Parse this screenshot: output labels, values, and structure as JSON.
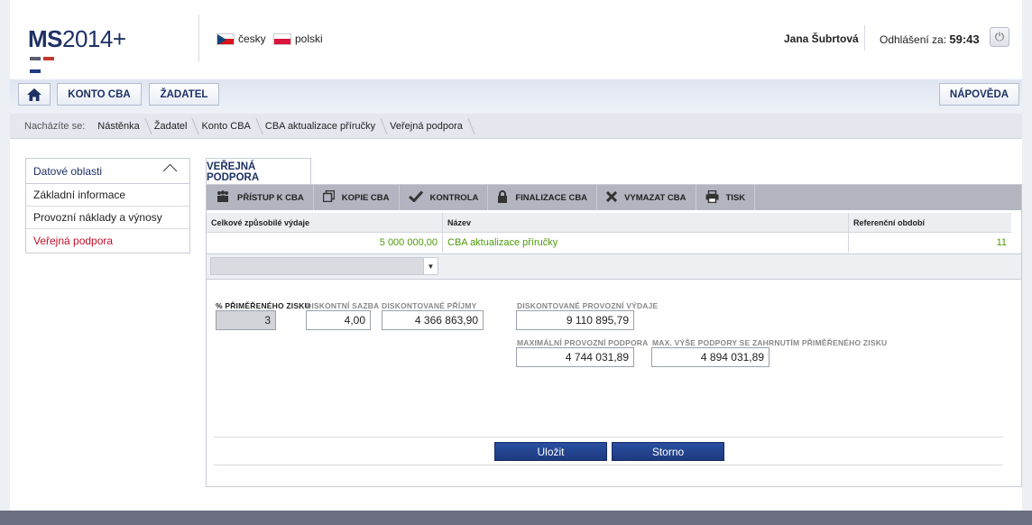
{
  "logo": {
    "bold": "MS",
    "rest": "2014+",
    "bar_colors": [
      "#5a6070",
      "#c0392b",
      "#1e3a80"
    ]
  },
  "languages": [
    {
      "label": "česky"
    },
    {
      "label": "polski"
    }
  ],
  "header": {
    "user_name": "Jana Šubrtová",
    "logout_label": "Odhlášení za:",
    "logout_timer": "59:43"
  },
  "nav": {
    "konto": "KONTO CBA",
    "zadatel": "ŽADATEL",
    "napoveda": "NÁPOVĚDA"
  },
  "breadcrumb": {
    "label": "Nacházíte se:",
    "items": [
      "Nástěnka",
      "Žadatel",
      "Konto CBA",
      "CBA aktualizace příručky",
      "Veřejná podpora"
    ]
  },
  "sidebar": {
    "title": "Datové oblasti",
    "items": [
      "Základní informace",
      "Provozní náklady a výnosy",
      "Veřejná podpora"
    ]
  },
  "tab": {
    "label": "VEŘEJNÁ PODPORA"
  },
  "toolbar": {
    "items": [
      "PŘÍSTUP K CBA",
      "KOPIE CBA",
      "KONTROLA",
      "FINALIZACE CBA",
      "VYMAZAT CBA",
      "TISK"
    ]
  },
  "grid": {
    "headers": [
      "Celkové způsobilé výdaje",
      "Název",
      "Referenční období"
    ],
    "row": [
      "5 000 000,00",
      "CBA aktualizace příručky",
      "11"
    ]
  },
  "form": {
    "pct_label": "% PŘIMĚŘENÉHO ZISKU",
    "pct_value": "3",
    "rate_label": "DISKONTNÍ SAZBA",
    "rate_value": "4,00",
    "income_label": "DISKONTOVANÉ PŘÍJMY",
    "income_value": "4 366 863,90",
    "opex_label": "DISKONTOVANÉ PROVOZNÍ VÝDAJE",
    "opex_value": "9 110 895,79",
    "max_label": "MAXIMÁLNÍ PROVOZNÍ PODPORA",
    "max_value": "4 744 031,89",
    "maxprofit_label": "MAX. VÝŠE PODPORY SE ZAHRNUTÍM PŘIMĚŘENÉHO ZISKU",
    "maxprofit_value": "4 894 031,89"
  },
  "actions": {
    "save": "Uložit",
    "cancel": "Storno"
  },
  "colors": {
    "brand": "#1e3164",
    "active": "#c0102a",
    "value_green": "#4e9a0a",
    "button_blue": "#1e3a80"
  }
}
